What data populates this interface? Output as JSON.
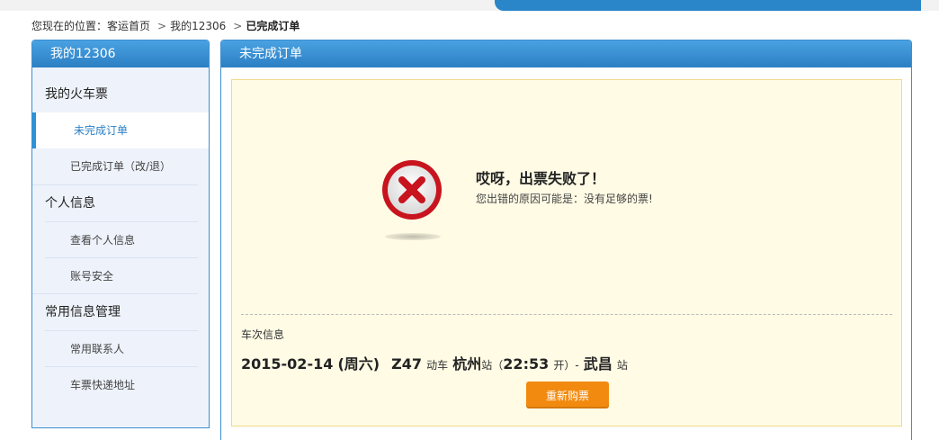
{
  "breadcrumb": {
    "prefix": "您现在的位置：",
    "home": "客运首页",
    "sep1": ">",
    "my12306": "我的12306",
    "sep2": ">",
    "current": "已完成订单"
  },
  "sidebar": {
    "title": "我的12306",
    "groups": [
      {
        "title": "我的火车票",
        "items": [
          {
            "label": "未完成订单",
            "active": true
          },
          {
            "label": "已完成订单（改/退）",
            "active": false
          }
        ]
      },
      {
        "title": "个人信息",
        "items": [
          {
            "label": "查看个人信息",
            "active": false
          },
          {
            "label": "账号安全",
            "active": false
          }
        ]
      },
      {
        "title": "常用信息管理",
        "items": [
          {
            "label": "常用联系人",
            "active": false
          },
          {
            "label": "车票快递地址",
            "active": false
          }
        ]
      }
    ]
  },
  "main": {
    "title": "未完成订单",
    "fail_icon": "error-x-icon",
    "fail_title": "哎呀，出票失败了！",
    "fail_reason": "您出错的原因可能是：没有足够的票!",
    "train_info_label": "车次信息",
    "train": {
      "date": "2015-02-14",
      "weekday": "(周六)",
      "number": "Z47",
      "type": "动车",
      "from": "杭州",
      "station_suffix": "站",
      "depart_open": "（",
      "depart_time": "22:53",
      "depart_suffix": "开）-",
      "to": "武昌",
      "to_suffix": "站"
    },
    "rebuy_label": "重新购票"
  },
  "colors": {
    "accent_blue": "#2b7fc4",
    "error_red": "#c8141e",
    "button_orange": "#f28a0f",
    "notice_bg": "#fffbe5"
  }
}
